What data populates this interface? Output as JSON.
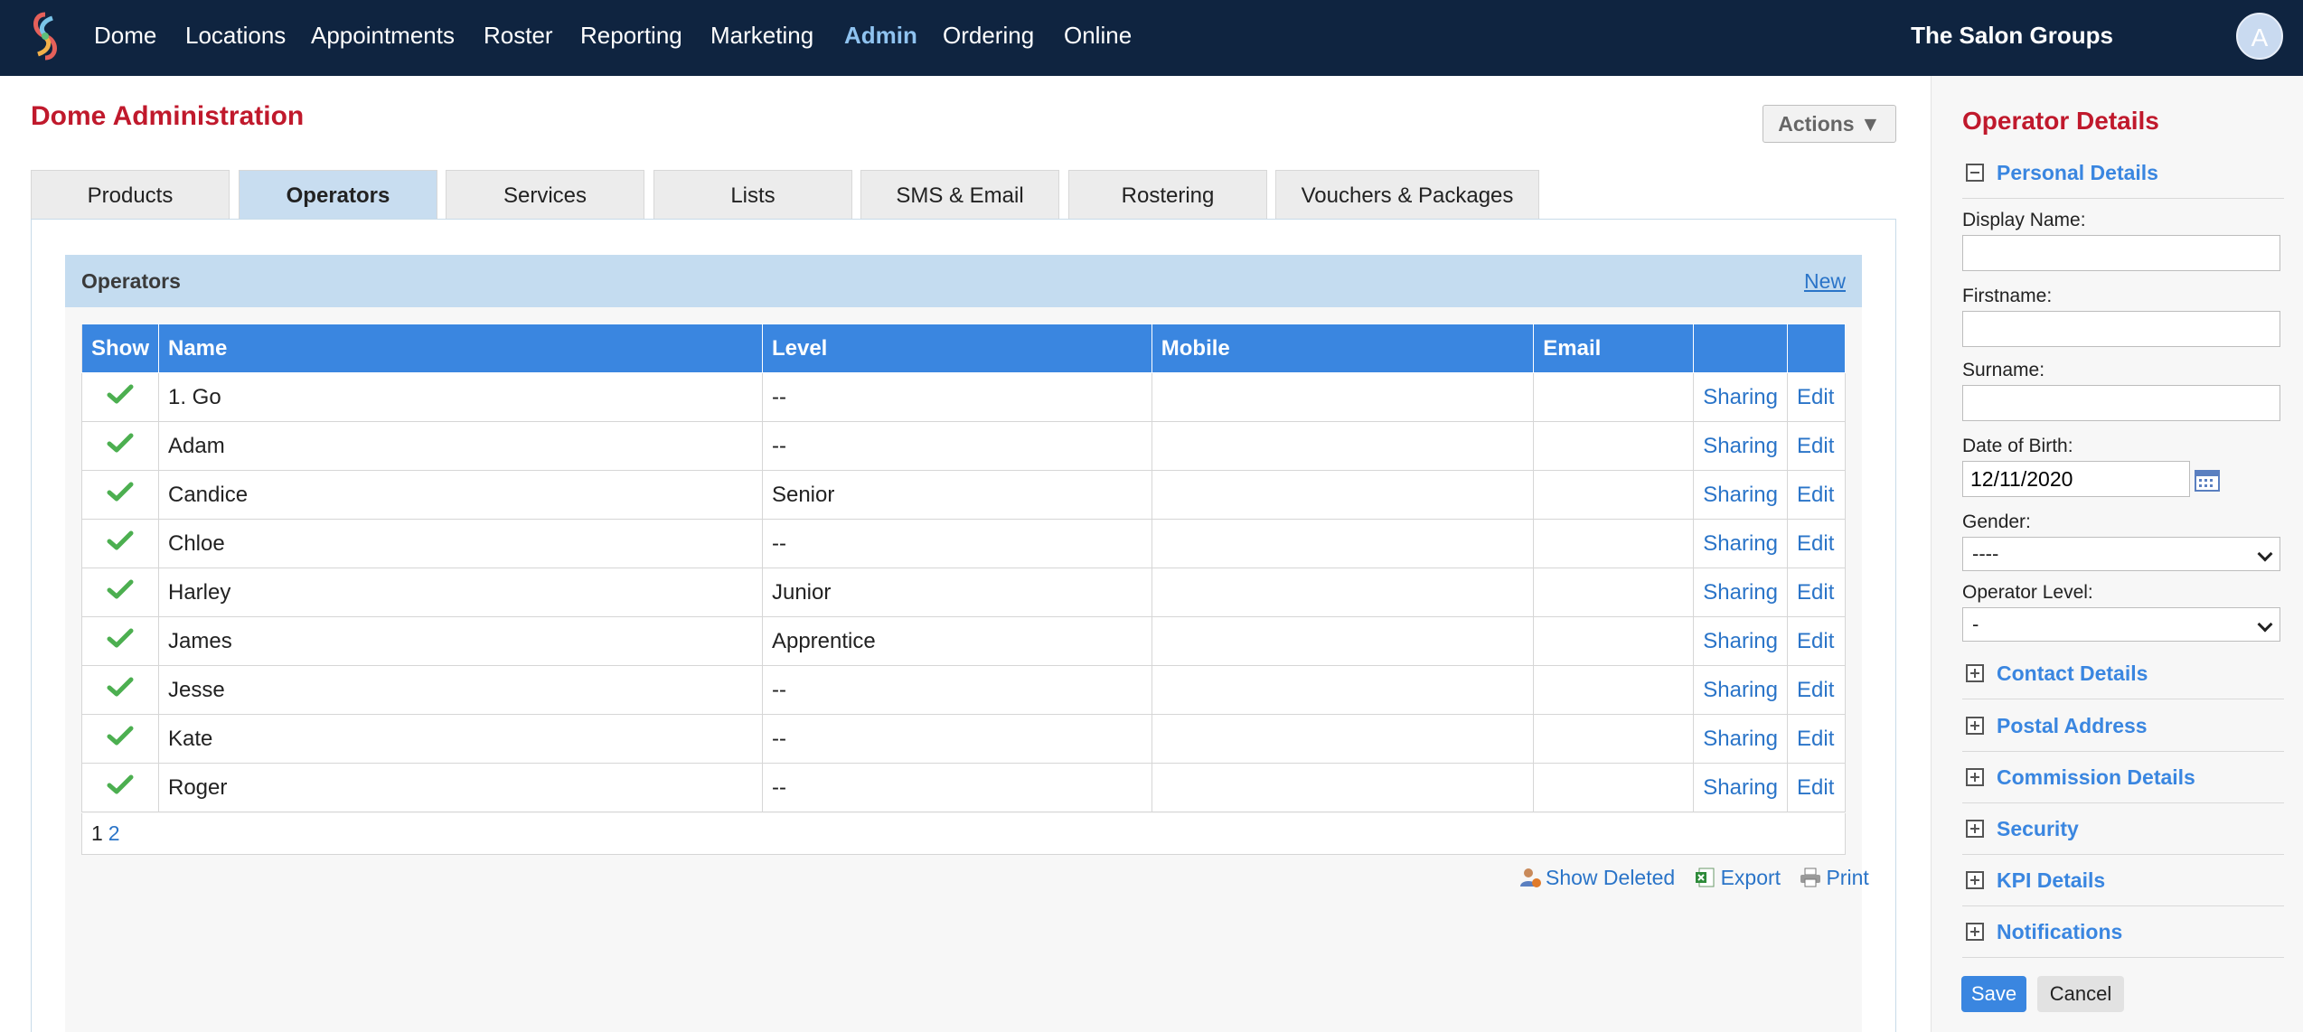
{
  "nav": {
    "items": [
      "Dome",
      "Locations",
      "Appointments",
      "Roster",
      "Reporting",
      "Marketing",
      "Admin",
      "Ordering",
      "Online"
    ],
    "active": "Admin",
    "org_name": "The Salon Groups",
    "avatar_initial": "A"
  },
  "page": {
    "title": "Dome Administration",
    "actions_label": "Actions ▼"
  },
  "tabs": [
    "Products",
    "Operators",
    "Services",
    "Lists",
    "SMS & Email",
    "Rostering",
    "Vouchers & Packages"
  ],
  "active_tab": "Operators",
  "operators": {
    "section_title": "Operators",
    "new_label": "New",
    "columns": [
      "Show",
      "Name",
      "Level",
      "Mobile",
      "Email",
      "",
      ""
    ],
    "rows": [
      {
        "name": "1. Go",
        "level": "--",
        "mobile": "",
        "email": "",
        "sharing": "Sharing",
        "edit": "Edit"
      },
      {
        "name": "Adam",
        "level": "--",
        "mobile": "",
        "email": "",
        "sharing": "Sharing",
        "edit": "Edit"
      },
      {
        "name": "Candice",
        "level": "Senior",
        "mobile": "",
        "email": "",
        "sharing": "Sharing",
        "edit": "Edit"
      },
      {
        "name": "Chloe",
        "level": "--",
        "mobile": "",
        "email": "",
        "sharing": "Sharing",
        "edit": "Edit"
      },
      {
        "name": "Harley",
        "level": "Junior",
        "mobile": "",
        "email": "",
        "sharing": "Sharing",
        "edit": "Edit"
      },
      {
        "name": "James",
        "level": "Apprentice",
        "mobile": "",
        "email": "",
        "sharing": "Sharing",
        "edit": "Edit"
      },
      {
        "name": "Jesse",
        "level": "--",
        "mobile": "",
        "email": "",
        "sharing": "Sharing",
        "edit": "Edit"
      },
      {
        "name": "Kate",
        "level": "--",
        "mobile": "",
        "email": "",
        "sharing": "Sharing",
        "edit": "Edit"
      },
      {
        "name": "Roger",
        "level": "--",
        "mobile": "",
        "email": "",
        "sharing": "Sharing",
        "edit": "Edit"
      }
    ],
    "pager": {
      "current": "1",
      "other": "2"
    },
    "footer": {
      "show_deleted": "Show Deleted",
      "export": "Export",
      "print": "Print"
    }
  },
  "side": {
    "title": "Operator Details",
    "personal_details": "Personal Details",
    "display_name_label": "Display Name:",
    "display_name_value": "",
    "firstname_label": "Firstname:",
    "firstname_value": "",
    "surname_label": "Surname:",
    "surname_value": "",
    "dob_label": "Date of Birth:",
    "dob_value": "12/11/2020",
    "gender_label": "Gender:",
    "gender_value": "----",
    "level_label": "Operator Level:",
    "level_value": "-",
    "sections": [
      "Contact Details",
      "Postal Address",
      "Commission Details",
      "Security",
      "KPI Details",
      "Notifications"
    ],
    "save": "Save",
    "cancel": "Cancel"
  },
  "colors": {
    "nav_bg": "#0f2440",
    "accent": "#3a86e0",
    "title_red": "#c0192c",
    "nav_active": "#8fc3f0",
    "check_green": "#4caf50"
  }
}
